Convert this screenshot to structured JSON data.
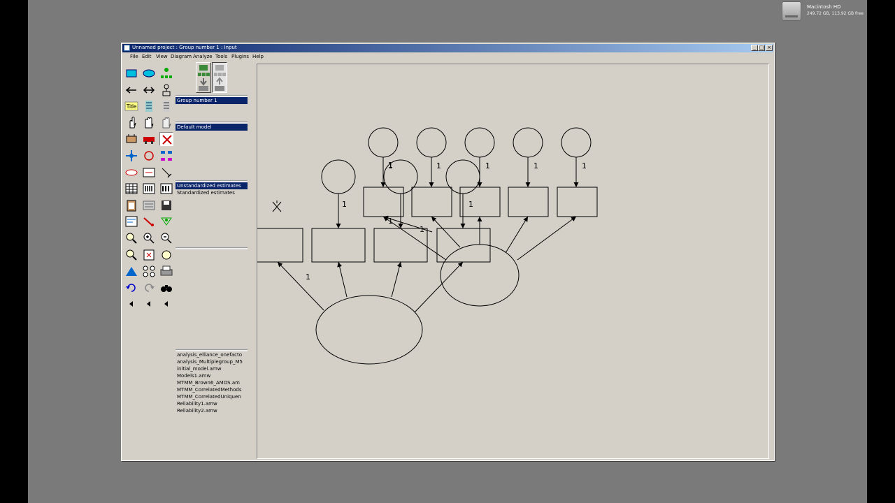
{
  "desktop": {
    "volume_name": "Macintosh HD",
    "volume_space": "249.72 GB, 113.92 GB free"
  },
  "window": {
    "title": "Unnamed project : Group number 1 : Input",
    "controls": {
      "minimize": "_",
      "maximize": "□",
      "close": "×"
    }
  },
  "menu": [
    "File",
    "Edit",
    "View",
    "Diagram",
    "Analyze",
    "Tools",
    "Plugins",
    "Help"
  ],
  "toolbox": {
    "title_tool_label": "Title",
    "icons": [
      "rectangle-icon",
      "ellipse-icon",
      "latent-indicator-icon",
      "single-arrow-icon",
      "double-arrow-icon",
      "unique-variable-icon",
      "title-icon",
      "list-variables-icon",
      "list-data-variables-icon",
      "select-one-icon",
      "select-all-icon",
      "deselect-icon",
      "duplicate-icon",
      "move-icon",
      "erase-icon",
      "move-parameter-icon",
      "rotate-icon",
      "reflect-icon",
      "shape-change-icon",
      "preserve-symmetry-icon",
      "drag-properties-icon",
      "data-files-icon",
      "analysis-properties-icon",
      "calculate-estimates-icon",
      "clipboard-icon",
      "view-text-icon",
      "save-icon",
      "object-properties-icon",
      "drag-icon",
      "preserve-icon",
      "zoom-area-icon",
      "zoom-in-icon",
      "zoom-out-icon",
      "zoom-page-icon",
      "fit-page-icon",
      "loupe-icon",
      "bayesian-icon",
      "multiple-group-icon",
      "print-icon",
      "undo-icon",
      "redo-icon",
      "specification-search-icon",
      "arrow-left-1",
      "arrow-left-2",
      "arrow-left-3"
    ]
  },
  "panels": {
    "groups": [
      "Group number 1"
    ],
    "models": [
      "Default model"
    ],
    "estimates": [
      "Unstandardized estimates",
      "Standardized estimates"
    ],
    "files": [
      "analysis_elliance_onefacto",
      "analysis_Multiplegroup_M5",
      "initial_model.amw",
      "Models1.amw",
      "MTMM_Brown6_AMOS.am",
      "MTMM_CorrelatedMethods",
      "MTMM_CorrelatedUniquen",
      "Reliability1.amw",
      "Reliability2.amw"
    ]
  },
  "diagram": {
    "path_labels": [
      "1",
      "1",
      "1",
      "1",
      "1",
      "1",
      "1",
      "1",
      "1",
      "1"
    ]
  }
}
